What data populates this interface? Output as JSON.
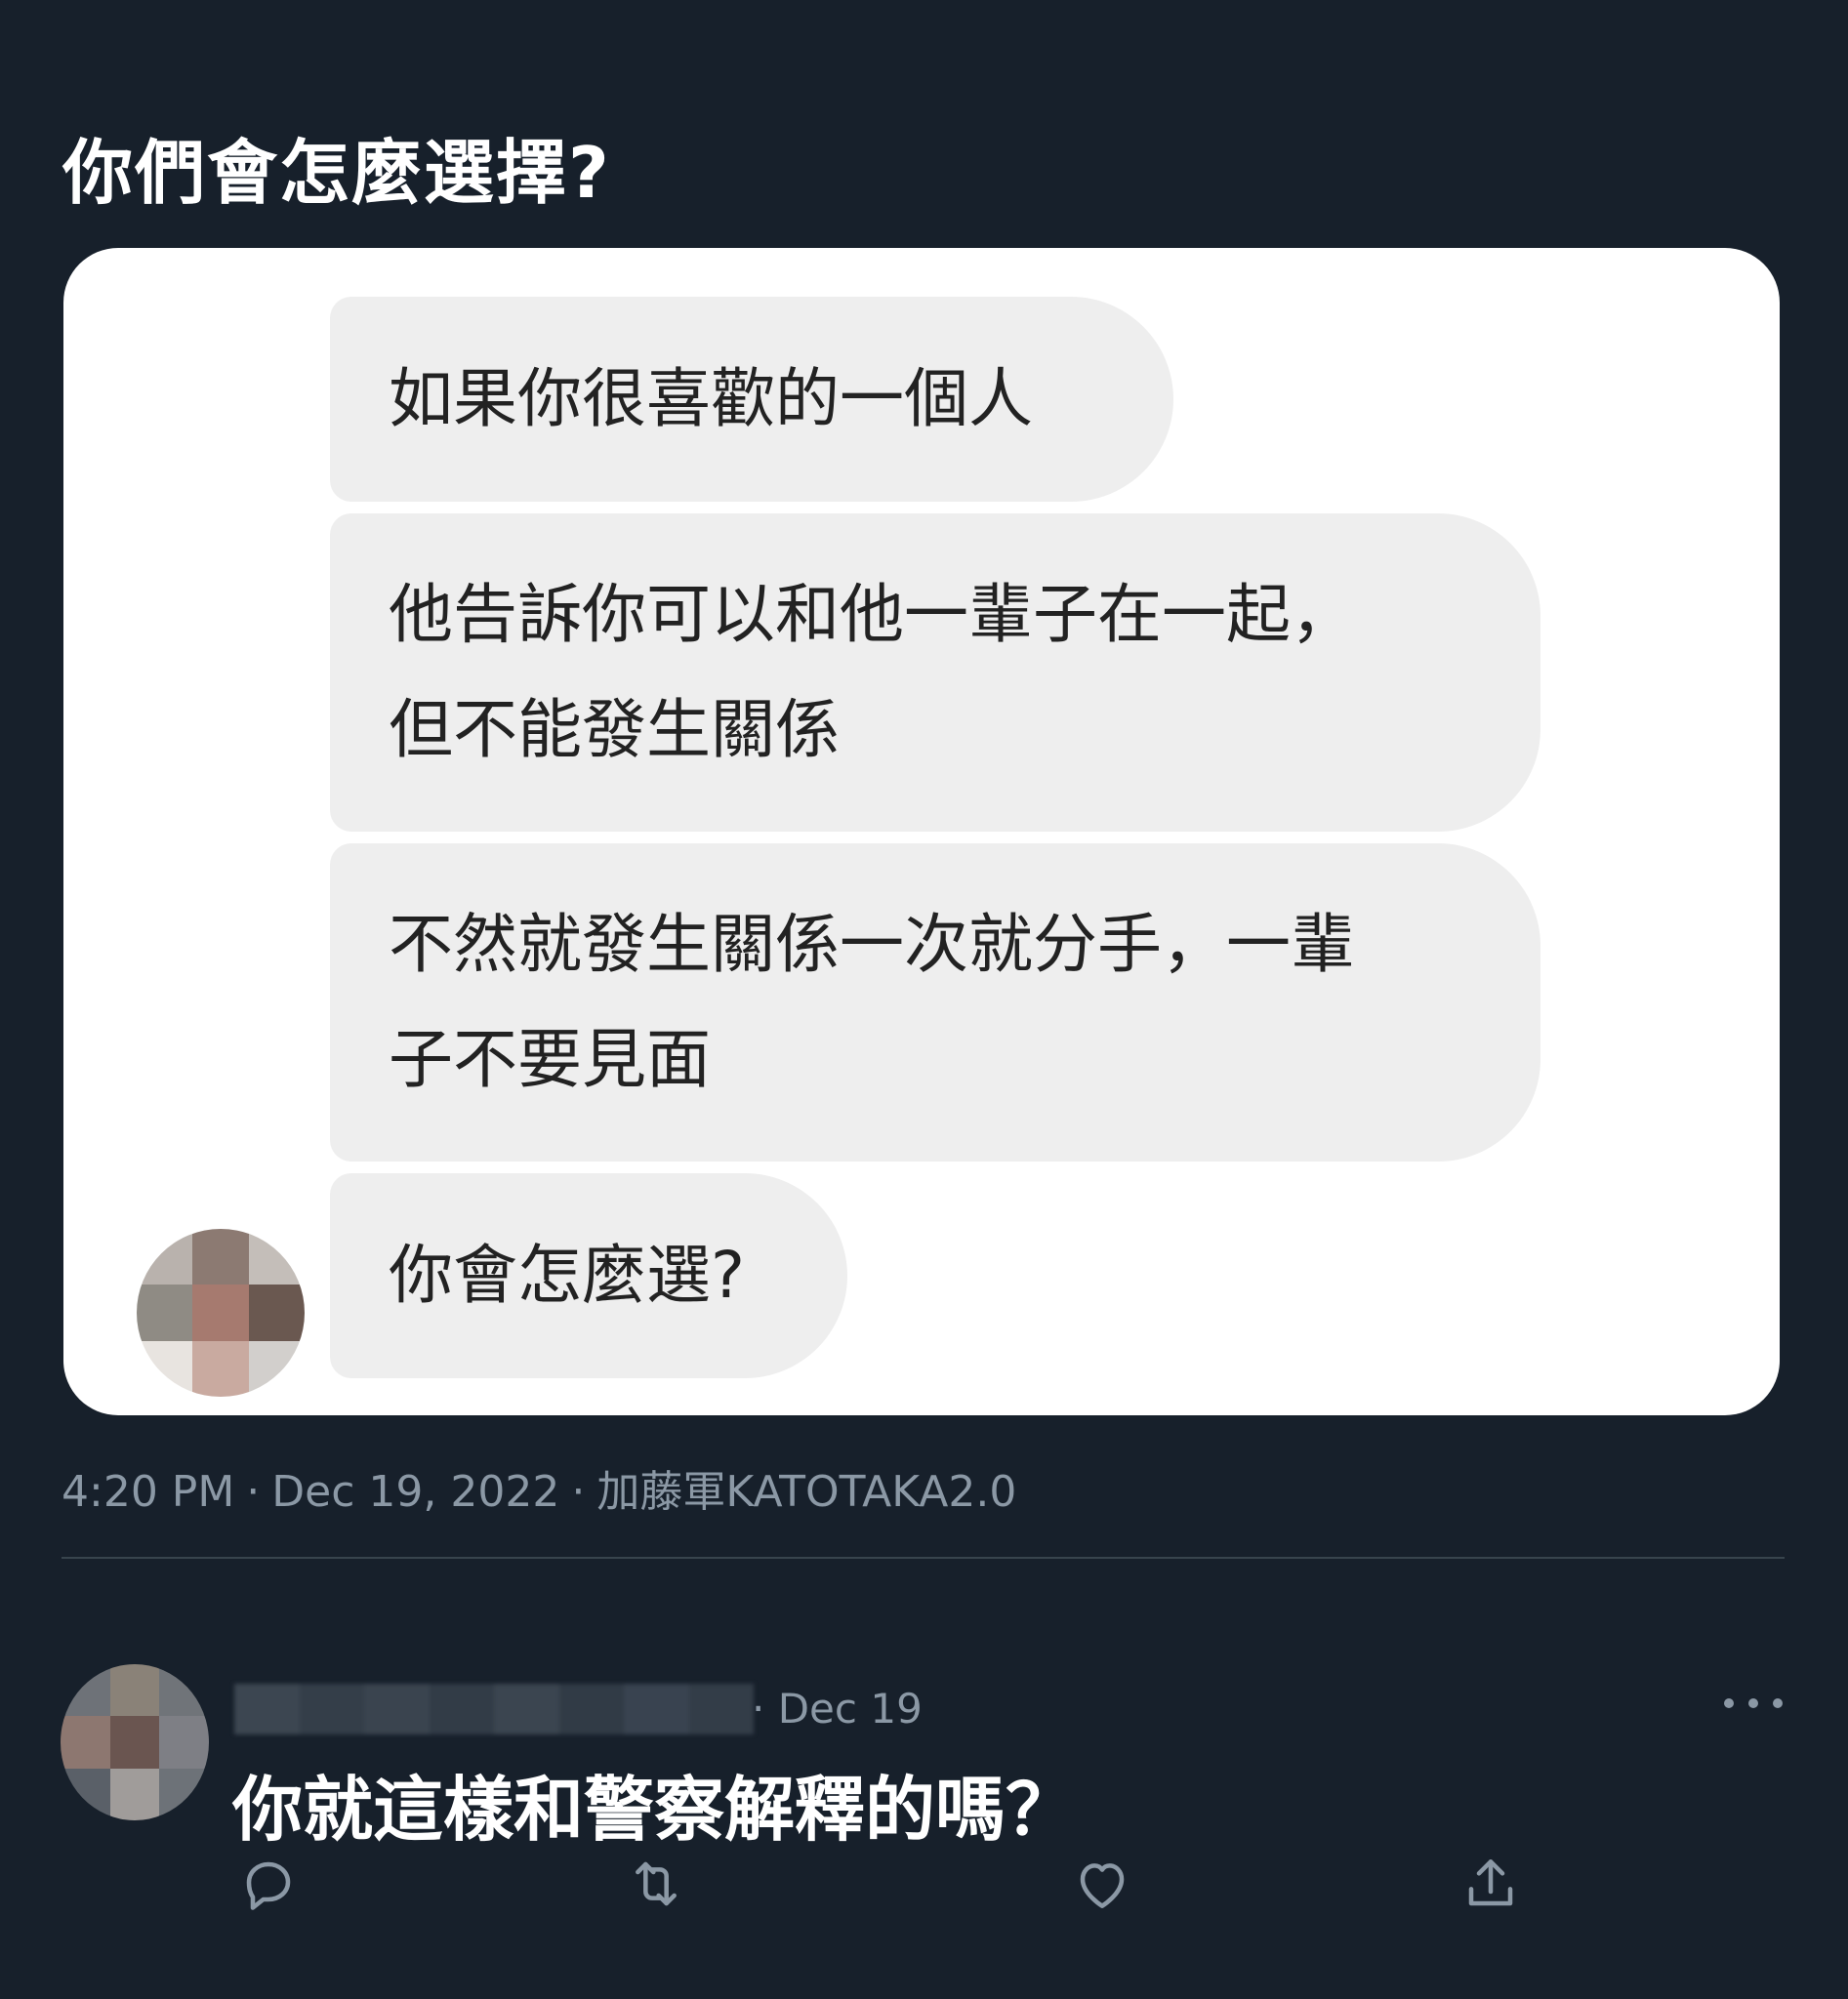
{
  "tweet": {
    "title": "你們會怎麼選擇?",
    "messages": [
      {
        "lines": [
          "如果你很喜歡的一個人"
        ]
      },
      {
        "lines": [
          "他告訴你可以和他一輩子在一起，",
          "但不能發生關係"
        ]
      },
      {
        "lines": [
          "不然就發生關係一次就分手，一輩",
          "子不要見面"
        ]
      },
      {
        "lines": [
          "你會怎麼選?"
        ]
      }
    ],
    "time": "4:20 PM",
    "date": "Dec 19, 2022",
    "source": "加藤軍KATOTAKA2.0",
    "separator": "·"
  },
  "reply": {
    "separator": "·",
    "date": "Dec 19",
    "text": "你就這樣和警察解釋的嗎？",
    "actions": [
      "reply-icon",
      "retweet-icon",
      "like-icon",
      "share-icon"
    ],
    "more_icon": "more-options-icon"
  },
  "colors": {
    "background": "#17202b",
    "card": "#ffffff",
    "bubble": "#eeeeee",
    "bubble_text": "#222222",
    "muted_text": "#8b98a5",
    "divider": "#38444d"
  }
}
